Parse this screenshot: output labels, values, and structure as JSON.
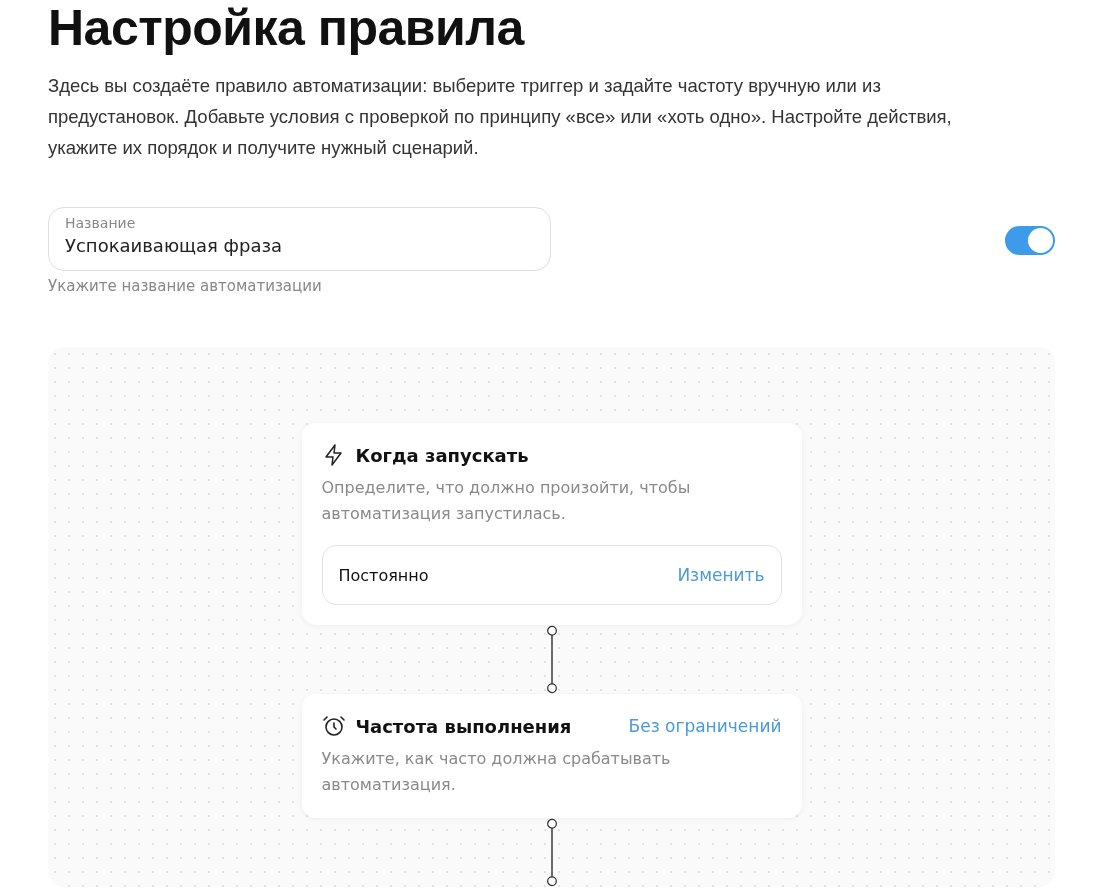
{
  "title": "Настройка правила",
  "description": "Здесь вы создаёте правило автоматизации: выберите триггер и задайте частоту вручную или из предустановок. Добавьте условия с проверкой по принципу «все» или «хоть одно». Настройте действия, укажите их порядок и получите нужный сценарий.",
  "name_field": {
    "label": "Название",
    "value": "Успокаивающая фраза",
    "hint": "Укажите название автоматизации"
  },
  "toggle": {
    "on": true
  },
  "steps": [
    {
      "kind": "trigger",
      "title": "Когда запускать",
      "description": "Определите, что должно произойти, чтобы автоматизация запустилась.",
      "option": {
        "value": "Постоянно",
        "action": "Изменить"
      }
    },
    {
      "kind": "frequency",
      "title": "Частота выполнения",
      "description": "Укажите, как часто должна срабатывать автоматизация.",
      "value": "Без ограничений"
    }
  ]
}
